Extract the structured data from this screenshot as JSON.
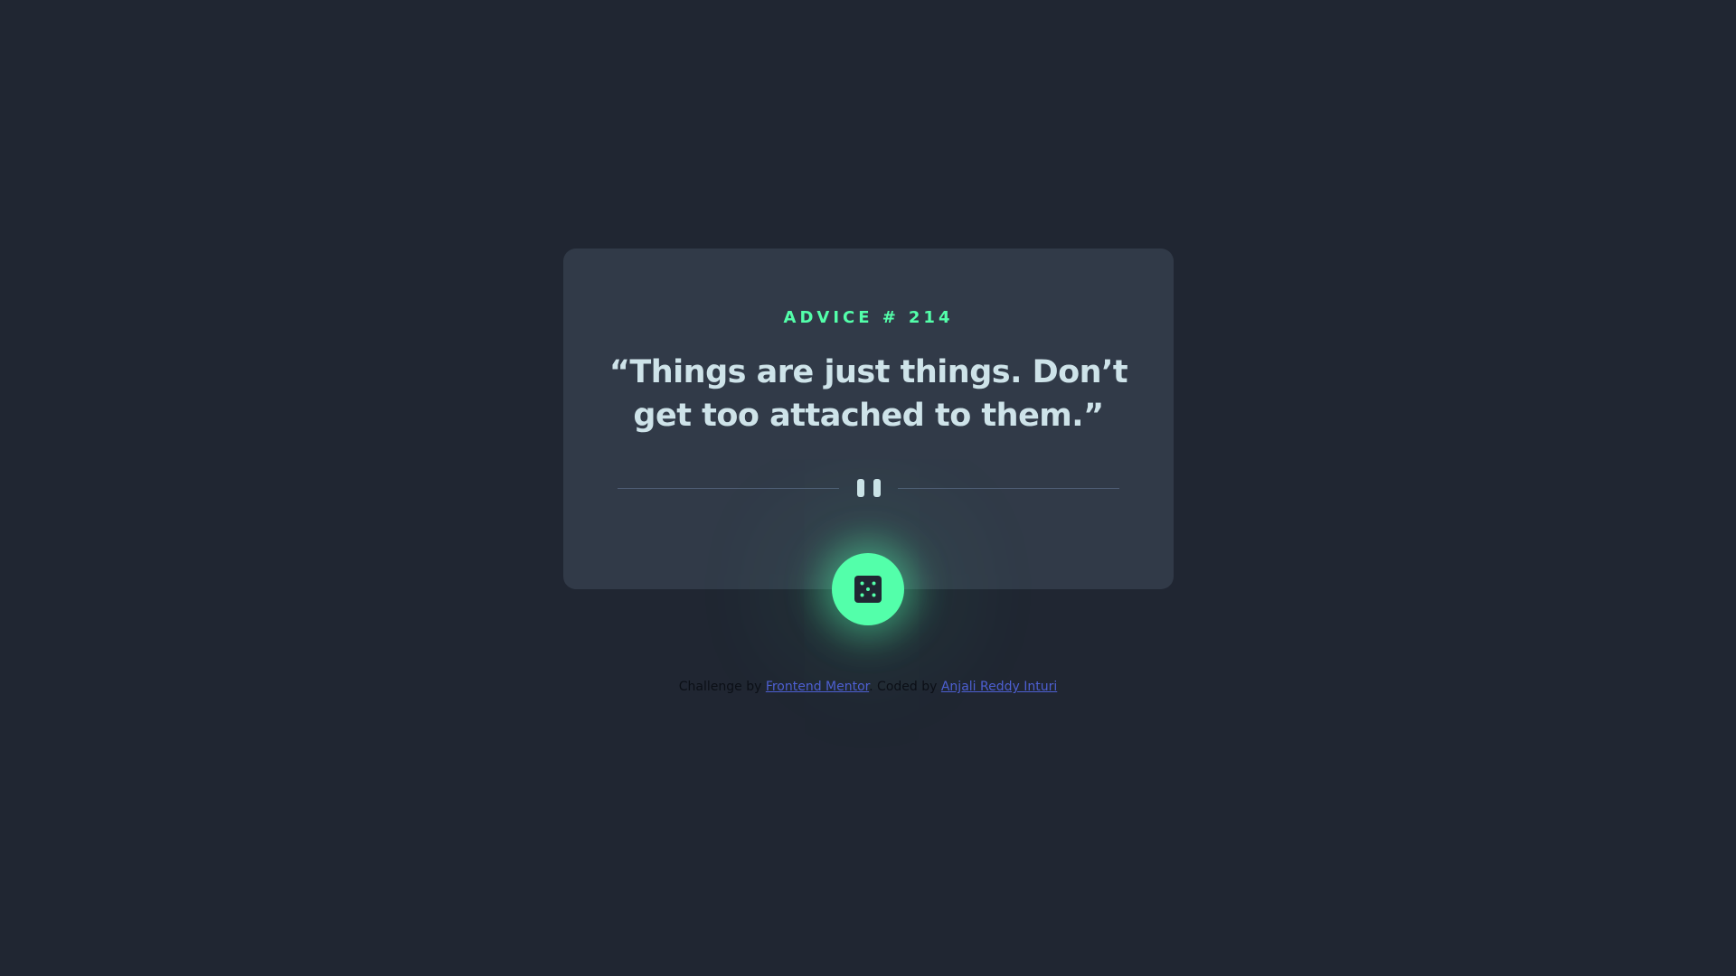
{
  "card": {
    "advice_label": "ADVICE #",
    "advice_number": "214",
    "quote": "“Things are just things. Don’t get too attached to them.”",
    "divider_icon": "pause-icon"
  },
  "dice_button": {
    "icon": "dice-icon"
  },
  "attribution": {
    "challenge_prefix": "Challenge by",
    "challenge_link": "Frontend Mentor",
    "coded_prefix": ". Coded by",
    "coded_link": "Anjali Reddy Inturi"
  },
  "colors": {
    "background": "#202632",
    "card": "#313A48",
    "accent_green": "#53FFAA",
    "text_light": "#CEE3E9",
    "divider": "#4F5D74",
    "link_blue": "#4D5FD1"
  }
}
